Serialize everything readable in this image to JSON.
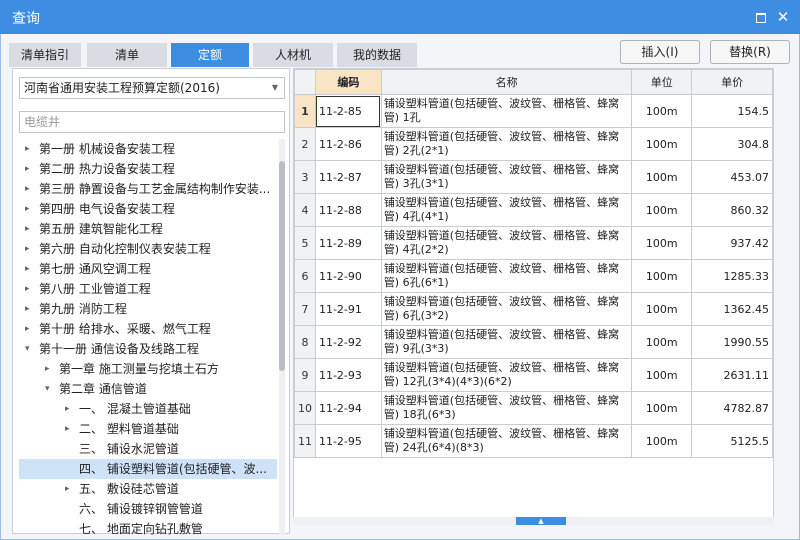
{
  "window": {
    "title": "查询"
  },
  "tabs": [
    {
      "label": "清单指引",
      "active": false
    },
    {
      "label": "清单",
      "active": false
    },
    {
      "label": "定额",
      "active": true
    },
    {
      "label": "人材机",
      "active": false
    },
    {
      "label": "我的数据",
      "active": false
    }
  ],
  "actions": {
    "insert_label": "插入(I)",
    "replace_label": "替换(R)"
  },
  "library": {
    "selected": "河南省通用安装工程预算定额(2016)"
  },
  "search": {
    "placeholder": "电缆井"
  },
  "tree": [
    {
      "label": "第一册 机械设备安装工程",
      "arrow": "▸",
      "level": 0
    },
    {
      "label": "第二册 热力设备安装工程",
      "arrow": "▸",
      "level": 0
    },
    {
      "label": "第三册 静置设备与工艺金属结构制作安装...",
      "arrow": "▸",
      "level": 0
    },
    {
      "label": "第四册 电气设备安装工程",
      "arrow": "▸",
      "level": 0
    },
    {
      "label": "第五册 建筑智能化工程",
      "arrow": "▸",
      "level": 0
    },
    {
      "label": "第六册 自动化控制仪表安装工程",
      "arrow": "▸",
      "level": 0
    },
    {
      "label": "第七册 通风空调工程",
      "arrow": "▸",
      "level": 0
    },
    {
      "label": "第八册 工业管道工程",
      "arrow": "▸",
      "level": 0
    },
    {
      "label": "第九册 消防工程",
      "arrow": "▸",
      "level": 0
    },
    {
      "label": "第十册 给排水、采暖、燃气工程",
      "arrow": "▸",
      "level": 0
    },
    {
      "label": "第十一册 通信设备及线路工程",
      "arrow": "▾",
      "level": 0
    },
    {
      "label": "第一章 施工测量与挖填土石方",
      "arrow": "▸",
      "level": 1
    },
    {
      "label": "第二章 通信管道",
      "arrow": "▾",
      "level": 1
    },
    {
      "label": "一、 混凝土管道基础",
      "arrow": "▸",
      "level": 2
    },
    {
      "label": "二、 塑料管道基础",
      "arrow": "▸",
      "level": 2
    },
    {
      "label": "三、 铺设水泥管道",
      "arrow": "",
      "level": 2
    },
    {
      "label": "四、 铺设塑料管道(包括硬管、波...",
      "arrow": "",
      "level": 2,
      "selected": true
    },
    {
      "label": "五、 敷设硅芯管道",
      "arrow": "▸",
      "level": 2
    },
    {
      "label": "六、 铺设镀锌钢管管道",
      "arrow": "",
      "level": 2
    },
    {
      "label": "七、 地面定向钻孔敷管",
      "arrow": "",
      "level": 2
    }
  ],
  "grid": {
    "columns": [
      "编码",
      "名称",
      "单位",
      "单价"
    ],
    "rows": [
      {
        "idx": "1",
        "code": "11-2-85",
        "name": "铺设塑料管道(包括硬管、波纹管、栅格管、蜂窝管) 1孔",
        "unit": "100m",
        "price": "154.5"
      },
      {
        "idx": "2",
        "code": "11-2-86",
        "name": "铺设塑料管道(包括硬管、波纹管、栅格管、蜂窝管) 2孔(2*1)",
        "unit": "100m",
        "price": "304.8"
      },
      {
        "idx": "3",
        "code": "11-2-87",
        "name": "铺设塑料管道(包括硬管、波纹管、栅格管、蜂窝管) 3孔(3*1)",
        "unit": "100m",
        "price": "453.07"
      },
      {
        "idx": "4",
        "code": "11-2-88",
        "name": "铺设塑料管道(包括硬管、波纹管、栅格管、蜂窝管) 4孔(4*1)",
        "unit": "100m",
        "price": "860.32"
      },
      {
        "idx": "5",
        "code": "11-2-89",
        "name": "铺设塑料管道(包括硬管、波纹管、栅格管、蜂窝管) 4孔(2*2)",
        "unit": "100m",
        "price": "937.42"
      },
      {
        "idx": "6",
        "code": "11-2-90",
        "name": "铺设塑料管道(包括硬管、波纹管、栅格管、蜂窝管) 6孔(6*1)",
        "unit": "100m",
        "price": "1285.33"
      },
      {
        "idx": "7",
        "code": "11-2-91",
        "name": "铺设塑料管道(包括硬管、波纹管、栅格管、蜂窝管) 6孔(3*2)",
        "unit": "100m",
        "price": "1362.45"
      },
      {
        "idx": "8",
        "code": "11-2-92",
        "name": "铺设塑料管道(包括硬管、波纹管、栅格管、蜂窝管) 9孔(3*3)",
        "unit": "100m",
        "price": "1990.55"
      },
      {
        "idx": "9",
        "code": "11-2-93",
        "name": "铺设塑料管道(包括硬管、波纹管、栅格管、蜂窝管) 12孔(3*4)(4*3)(6*2)",
        "unit": "100m",
        "price": "2631.11"
      },
      {
        "idx": "10",
        "code": "11-2-94",
        "name": "铺设塑料管道(包括硬管、波纹管、栅格管、蜂窝管) 18孔(6*3)",
        "unit": "100m",
        "price": "4782.87"
      },
      {
        "idx": "11",
        "code": "11-2-95",
        "name": "铺设塑料管道(包括硬管、波纹管、栅格管、蜂窝管) 24孔(6*4)(8*3)",
        "unit": "100m",
        "price": "5125.5"
      }
    ]
  },
  "colors": {
    "accent": "#3d8ee3",
    "highlight_header": "#f9e4c6",
    "selected_row": "#cfe3f8"
  }
}
